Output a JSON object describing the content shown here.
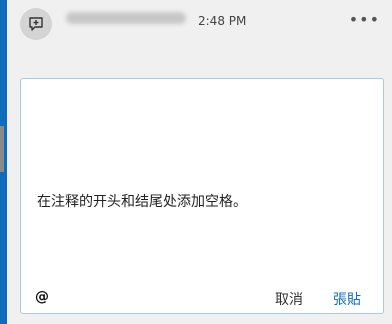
{
  "header": {
    "time": "2:48 PM",
    "more_glyph": "•••"
  },
  "comment": {
    "text": "在注释的开头和结尾处添加空格。"
  },
  "actions": {
    "mention_glyph": "@",
    "cancel_label": "取消",
    "post_label": "張貼"
  },
  "colors": {
    "accent": "#0f6cbd",
    "card_border": "#a8c8e8"
  },
  "icons": [
    "comment-icon",
    "more-icon",
    "mention-icon"
  ]
}
